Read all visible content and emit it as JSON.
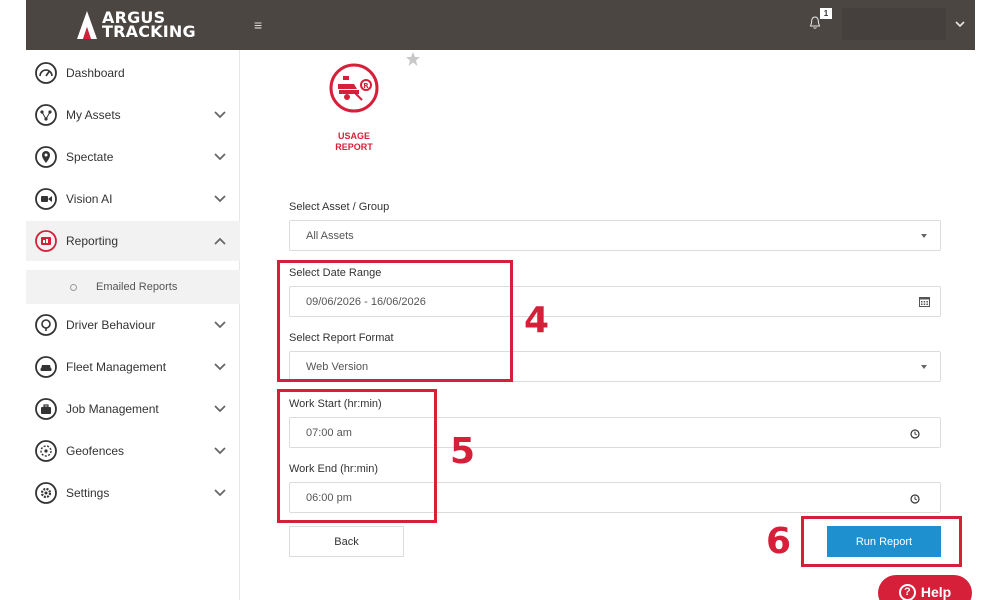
{
  "brand": {
    "line1": "ARGUS",
    "line2": "TRACKING",
    "accent": "#d6203a",
    "topbar_color": "#4c4643"
  },
  "header": {
    "notification_count": "1"
  },
  "sidebar": {
    "items": [
      {
        "label": "Dashboard",
        "icon": "dashboard-icon"
      },
      {
        "label": "My Assets",
        "icon": "assets-icon"
      },
      {
        "label": "Spectate",
        "icon": "location-pin-icon"
      },
      {
        "label": "Vision AI",
        "icon": "video-camera-icon"
      },
      {
        "label": "Reporting",
        "icon": "reporting-icon"
      },
      {
        "label": "Driver Behaviour",
        "icon": "driver-icon"
      },
      {
        "label": "Fleet Management",
        "icon": "car-icon"
      },
      {
        "label": "Job Management",
        "icon": "briefcase-icon"
      },
      {
        "label": "Geofences",
        "icon": "geofence-icon"
      },
      {
        "label": "Settings",
        "icon": "gear-icon"
      }
    ],
    "sub_item": "Emailed Reports"
  },
  "report": {
    "title_line1": "USAGE",
    "title_line2": "REPORT"
  },
  "form": {
    "asset_label": "Select Asset / Group",
    "asset_value": "All Assets",
    "date_label": "Select Date Range",
    "date_value": "09/06/2026 - 16/06/2026",
    "format_label": "Select Report Format",
    "format_value": "Web Version",
    "work_start_label": "Work Start (hr:min)",
    "work_start_value": "07:00 am",
    "work_end_label": "Work End (hr:min)",
    "work_end_value": "06:00 pm"
  },
  "buttons": {
    "back": "Back",
    "run": "Run Report",
    "help": "Help"
  },
  "annotations": {
    "a4": "4",
    "a5": "5",
    "a6": "6"
  }
}
